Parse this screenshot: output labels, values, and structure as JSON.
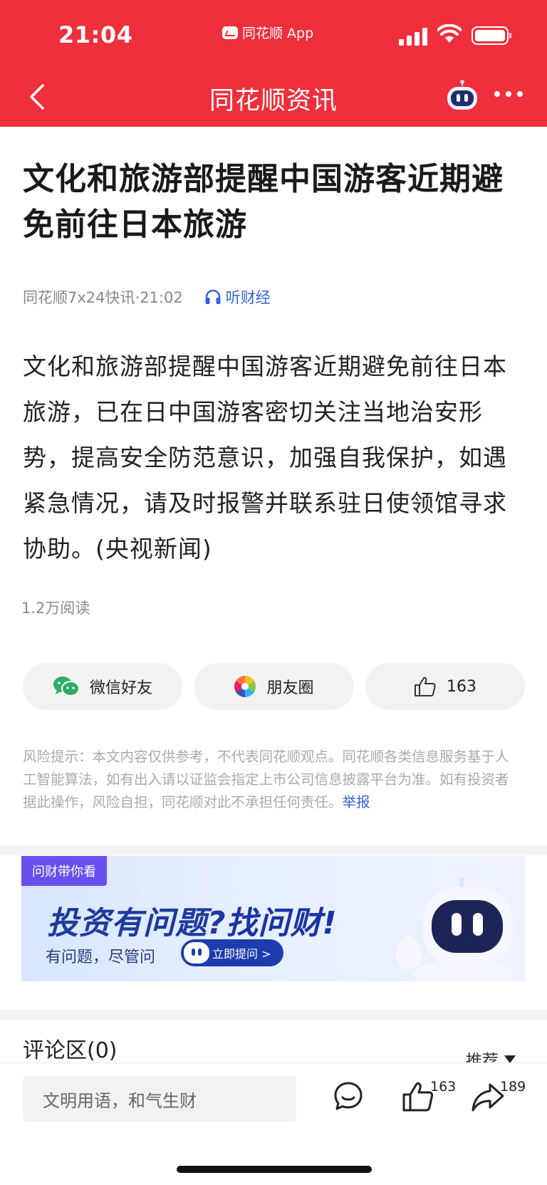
{
  "status_bar": {
    "time": "21:04",
    "app_name": "同花顺 App"
  },
  "nav": {
    "title": "同花顺资讯",
    "back_icon": "chevron-left-icon",
    "assistant_icon": "robot-icon",
    "more_icon": "more-icon"
  },
  "article": {
    "title": "文化和旅游部提醒中国游客近期避免前往日本旅游",
    "source": "同花顺7x24快讯·21:02",
    "listen_label": "听财经",
    "body": "文化和旅游部提醒中国游客近期避免前往日本旅游，已在日中国游客密切关注当地治安形势，提高安全防范意识，加强自我保护，如遇紧急情况，请及时报警并联系驻日使领馆寻求协助。(央视新闻)",
    "views": "1.2万阅读"
  },
  "share": {
    "wechat_label": "微信好友",
    "moments_label": "朋友圈",
    "like_count": "163"
  },
  "risk": {
    "text": "风险提示：本文内容仅供参考，不代表同花顺观点。同花顺各类信息服务基于人工智能算法，如有出入请以证监会指定上市公司信息披露平台为准。如有投资者据此操作，风险自担，同花顺对此不承担任何责任。",
    "report_label": "举报"
  },
  "banner": {
    "tag": "问财带你看",
    "headline_part1": "投资有问题?",
    "headline_part2": "找问财!",
    "subtitle": "有问题，尽管问",
    "cta": "立即提问 >"
  },
  "comments": {
    "title": "评论区(0)",
    "sort_label": "推荐"
  },
  "bottom_bar": {
    "input_placeholder": "文明用语，和气生财",
    "like_count": "163",
    "share_count": "189"
  },
  "colors": {
    "brand_red": "#ef2f3b",
    "link_blue": "#3561d6",
    "wechat_green": "#2aae67"
  }
}
